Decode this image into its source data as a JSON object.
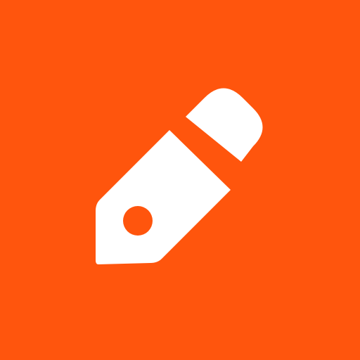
{
  "icon": {
    "name": "pencil-icon",
    "background_color": "#FF550D",
    "glyph_color": "#FFFFFF"
  }
}
